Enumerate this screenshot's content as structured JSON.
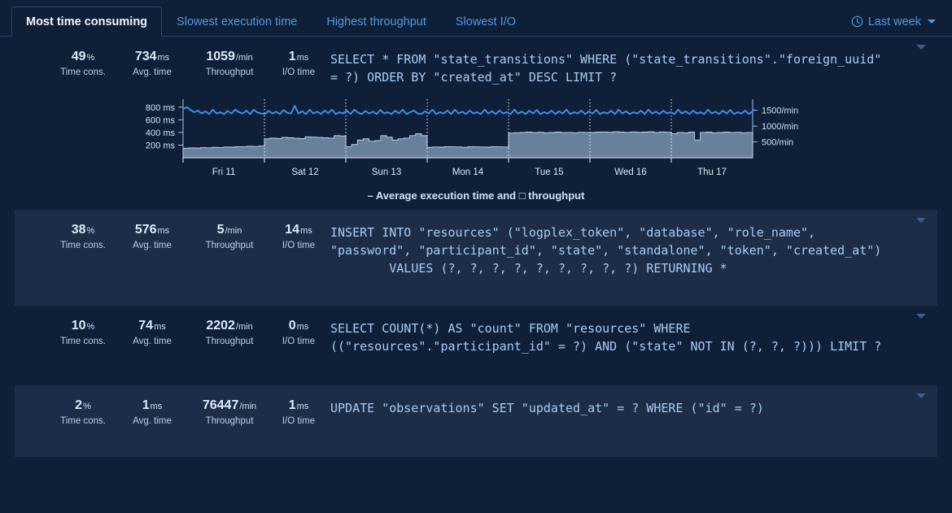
{
  "tabs": [
    {
      "label": "Most time consuming",
      "active": true
    },
    {
      "label": "Slowest execution time",
      "active": false
    },
    {
      "label": "Highest throughput",
      "active": false
    },
    {
      "label": "Slowest I/O",
      "active": false
    }
  ],
  "timerange": {
    "icon": "clock-icon",
    "label": "Last week",
    "caret": "chevron-down-icon"
  },
  "metric_labels": {
    "time_cons": "Time cons.",
    "avg_time": "Avg. time",
    "throughput": "Throughput",
    "io_time": "I/O time"
  },
  "units": {
    "percent": "%",
    "ms": "ms",
    "per_min": "/min"
  },
  "rows": [
    {
      "time_cons": "49",
      "avg_time": "734",
      "throughput": "1059",
      "io_time": "1",
      "sql": "SELECT * FROM \"state_transitions\" WHERE (\"state_transitions\".\"foreign_uuid\"\n= ?) ORDER BY \"created_at\" DESC LIMIT ?",
      "expanded": true,
      "shaded": false
    },
    {
      "time_cons": "38",
      "avg_time": "576",
      "throughput": "5",
      "io_time": "14",
      "sql": "INSERT INTO \"resources\" (\"logplex_token\", \"database\", \"role_name\",\n\"password\", \"participant_id\", \"state\", \"standalone\", \"token\", \"created_at\")\n        VALUES (?, ?, ?, ?, ?, ?, ?, ?, ?) RETURNING *",
      "expanded": false,
      "shaded": true
    },
    {
      "time_cons": "10",
      "avg_time": "74",
      "throughput": "2202",
      "io_time": "0",
      "sql": "SELECT COUNT(*) AS \"count\" FROM \"resources\" WHERE\n((\"resources\".\"participant_id\" = ?) AND (\"state\" NOT IN (?, ?, ?))) LIMIT ?",
      "expanded": false,
      "shaded": false
    },
    {
      "time_cons": "2",
      "avg_time": "1",
      "throughput": "76447",
      "io_time": "1",
      "sql": "UPDATE \"observations\" SET \"updated_at\" = ? WHERE (\"id\" = ?)",
      "expanded": false,
      "shaded": true
    }
  ],
  "chart_data": {
    "type": "line",
    "title": "",
    "legend": "– Average execution time and □ throughput",
    "legend_position": "bottom",
    "grid": false,
    "xlabel": "",
    "x_tick_labels": [
      "Fri 11",
      "Sat 12",
      "Sun 13",
      "Mon 14",
      "Tue 15",
      "Wed 16",
      "Thu 17"
    ],
    "y_left": {
      "label": "Average execution time",
      "ticks": [
        "800 ms",
        "600 ms",
        "400 ms",
        "200 ms"
      ],
      "tick_values": [
        800,
        600,
        400,
        200
      ],
      "range": [
        0,
        900
      ]
    },
    "y_right": {
      "label": "throughput",
      "ticks": [
        "1500/min",
        "1000/min",
        "500/min"
      ],
      "tick_values": [
        1500,
        1000,
        500
      ],
      "range": [
        0,
        1800
      ]
    },
    "series": [
      {
        "name": "Average execution time",
        "type": "line",
        "color": "#3b8ee8",
        "axis": "left",
        "values": [
          770,
          800,
          755,
          720,
          745,
          700,
          735,
          690,
          760,
          700,
          720,
          690,
          740,
          700,
          760,
          720,
          700,
          745,
          690,
          760,
          715,
          700,
          690,
          740,
          700,
          730,
          690,
          755,
          710,
          700,
          820,
          700,
          735,
          690,
          760,
          700,
          730,
          690,
          745,
          705,
          760,
          690,
          720,
          700,
          745,
          690,
          760,
          715,
          690,
          740,
          700,
          730,
          690,
          755,
          700,
          720,
          690,
          745,
          700,
          760,
          690,
          720,
          745,
          700,
          690,
          735,
          700,
          760,
          690,
          720,
          700,
          745,
          690,
          760,
          700,
          730,
          690,
          745,
          700,
          720,
          690,
          760,
          700,
          735,
          690,
          745,
          700,
          720,
          690,
          760,
          700,
          730,
          690,
          745,
          700,
          755,
          690,
          720,
          700,
          745,
          690,
          735,
          700,
          760,
          690,
          720,
          700,
          745,
          690,
          730,
          700,
          755,
          690,
          720,
          700,
          745,
          690,
          760,
          700,
          735,
          690,
          720,
          700,
          745,
          690,
          760,
          700,
          730,
          690,
          745,
          700,
          720,
          690,
          760,
          700,
          735,
          690,
          745,
          700,
          720,
          690,
          760,
          700,
          730,
          690,
          745,
          700,
          755,
          690,
          720,
          700,
          745,
          690,
          735
        ],
        "note": "fluctuating around 650-820 ms across the week"
      },
      {
        "name": "throughput",
        "type": "step-area",
        "color": "#7f99b4",
        "axis": "right",
        "values": [
          300,
          310,
          305,
          320,
          315,
          330,
          325,
          340,
          335,
          350,
          345,
          360,
          355,
          370,
          600,
          620,
          610,
          640,
          630,
          615,
          605,
          660,
          650,
          640,
          630,
          620,
          700,
          690,
          350,
          420,
          560,
          600,
          520,
          540,
          700,
          650,
          560,
          600,
          620,
          700,
          760,
          700,
          330,
          340,
          335,
          350,
          345,
          340,
          330,
          350,
          345,
          340,
          335,
          350,
          345,
          340,
          780,
          790,
          800,
          810,
          795,
          805,
          790,
          800,
          810,
          795,
          800,
          790,
          805,
          800,
          800,
          810,
          815,
          805,
          820,
          810,
          800,
          815,
          805,
          810,
          820,
          800,
          815,
          805,
          760,
          800,
          790,
          810,
          560,
          800,
          810,
          790,
          800,
          810,
          795,
          805,
          790,
          800
        ],
        "note": "step area chart, higher plateaus mid-to-late week"
      }
    ]
  }
}
